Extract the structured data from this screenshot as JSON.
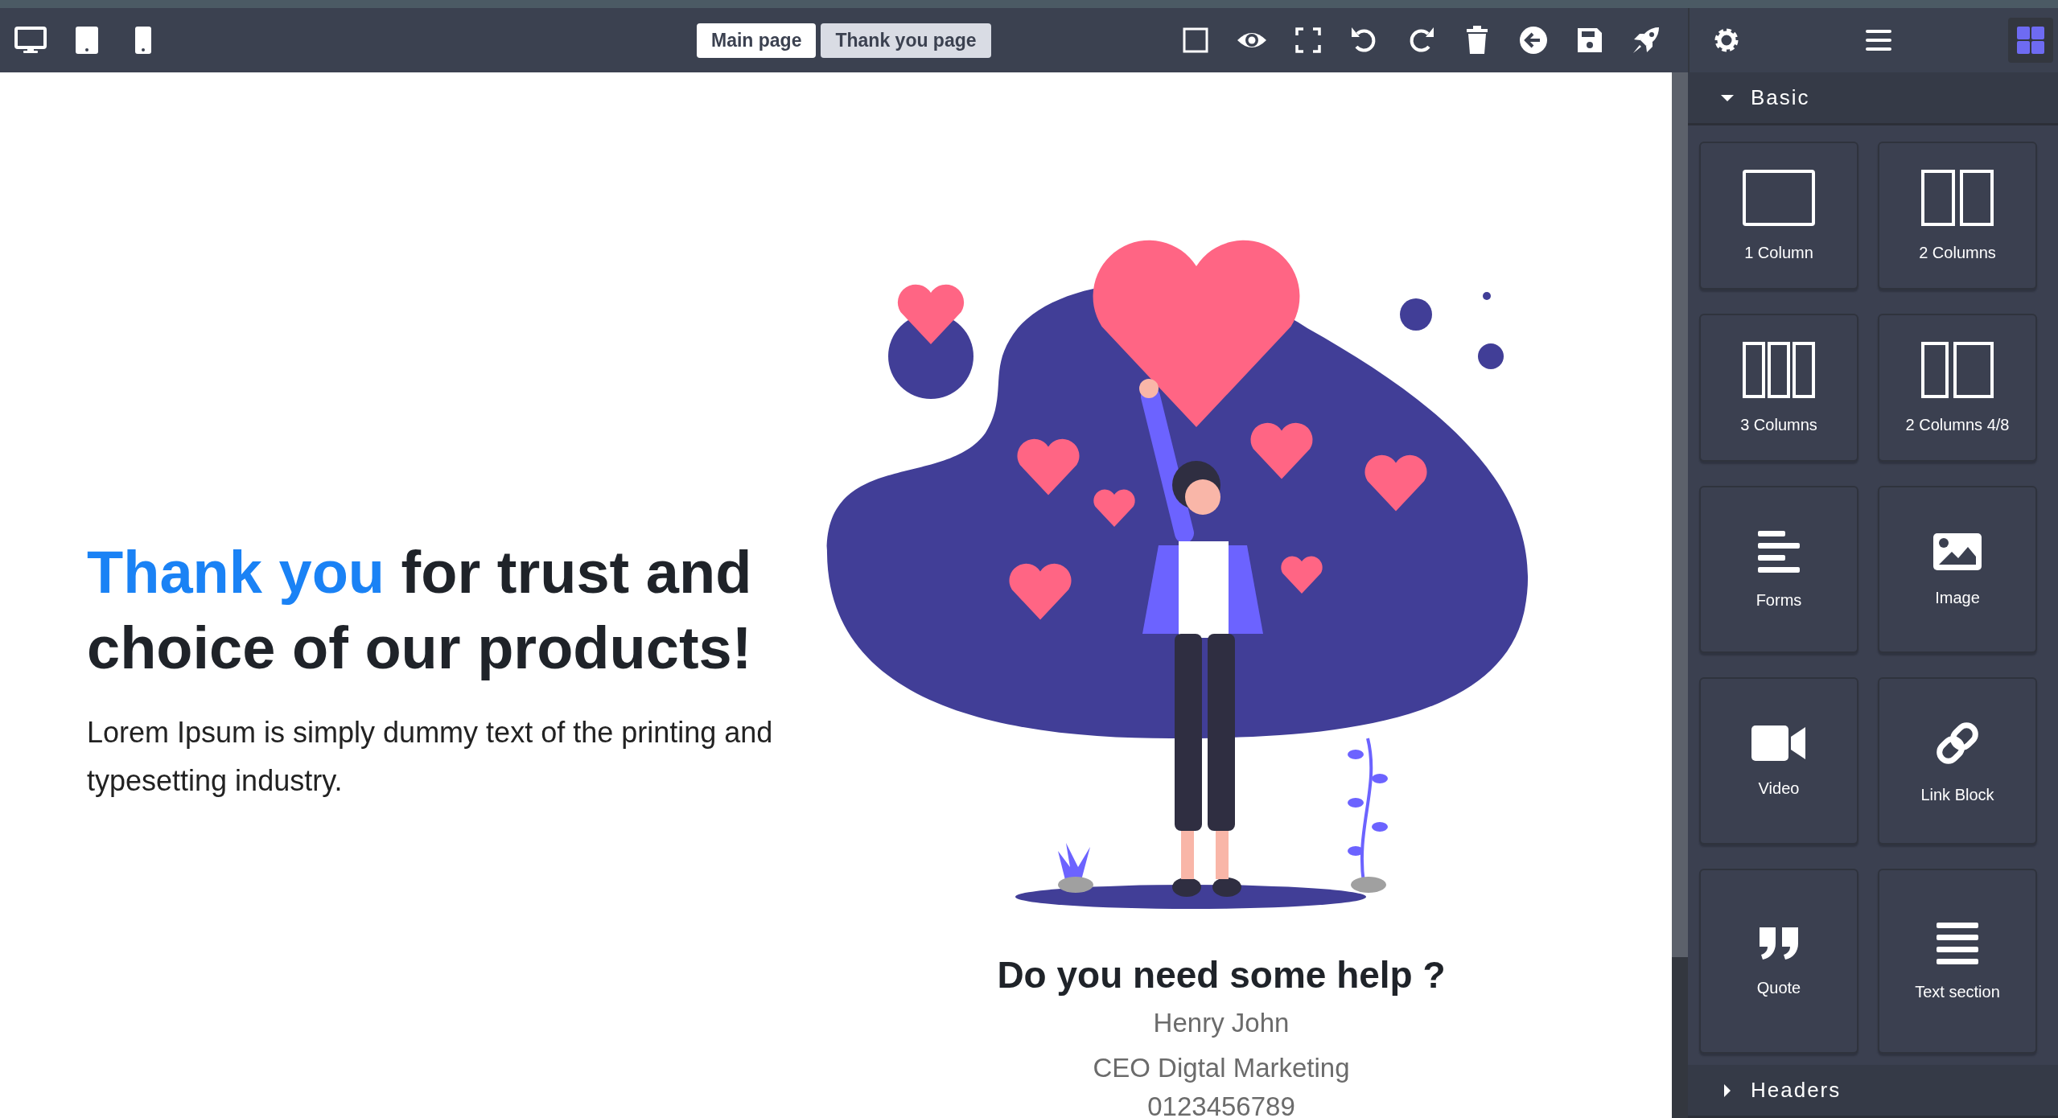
{
  "top_bar": {
    "pages": [
      {
        "label": "Main page",
        "selected": false
      },
      {
        "label": "Thank you page",
        "selected": true
      }
    ]
  },
  "panel_tabs": [
    {
      "selected": false
    },
    {
      "selected": false
    },
    {
      "selected": true
    }
  ],
  "canvas": {
    "heading": {
      "highlight": "Thank you",
      "rest": "for trust and choice of our products!"
    },
    "paragraph": "Lorem Ipsum is simply dummy text of the printing and typesetting industry.",
    "help": {
      "title": "Do you need some help ?",
      "name": "Henry John",
      "role": "CEO Digtal Marketing",
      "phone": "0123456789"
    }
  },
  "block_categories": [
    {
      "label": "Basic",
      "expanded": true,
      "blocks": [
        {
          "label": "1 Column",
          "kind": "col1"
        },
        {
          "label": "2 Columns",
          "kind": "col2"
        },
        {
          "label": "3 Columns",
          "kind": "col3"
        },
        {
          "label": "2 Columns 4/8",
          "kind": "col48"
        },
        {
          "label": "Forms",
          "kind": "forms"
        },
        {
          "label": "Image",
          "kind": "image"
        },
        {
          "label": "Video",
          "kind": "video"
        },
        {
          "label": "Link Block",
          "kind": "link"
        },
        {
          "label": "Quote",
          "kind": "quote"
        },
        {
          "label": "Text section",
          "kind": "text"
        }
      ]
    },
    {
      "label": "Headers",
      "expanded": false
    }
  ]
}
